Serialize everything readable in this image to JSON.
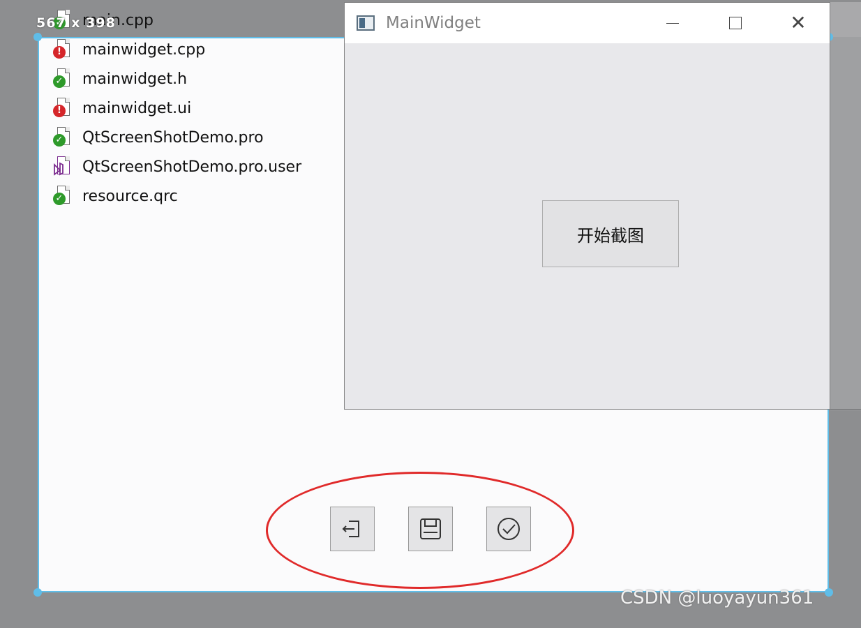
{
  "screenshot_tool": {
    "size_label": "567 x 398",
    "toolbar": {
      "exit_icon": "exit-icon",
      "save_icon": "floppy-disk-icon",
      "confirm_icon": "check-circle-icon"
    },
    "annotation_color": "#e02a2a",
    "selection_color": "#5fbde8"
  },
  "file_list": [
    {
      "name": "main.cpp",
      "status": "ok"
    },
    {
      "name": "mainwidget.cpp",
      "status": "error"
    },
    {
      "name": "mainwidget.h",
      "status": "ok"
    },
    {
      "name": "mainwidget.ui",
      "status": "error"
    },
    {
      "name": "QtScreenShotDemo.pro",
      "status": "ok"
    },
    {
      "name": "QtScreenShotDemo.pro.user",
      "status": "vs"
    },
    {
      "name": "resource.qrc",
      "status": "ok"
    }
  ],
  "window": {
    "title": "MainWidget",
    "minimize_glyph": "—",
    "maximize_glyph": "☐",
    "close_glyph": "✕",
    "start_button_label": "开始截图"
  },
  "watermark": "CSDN @luoyayun361"
}
